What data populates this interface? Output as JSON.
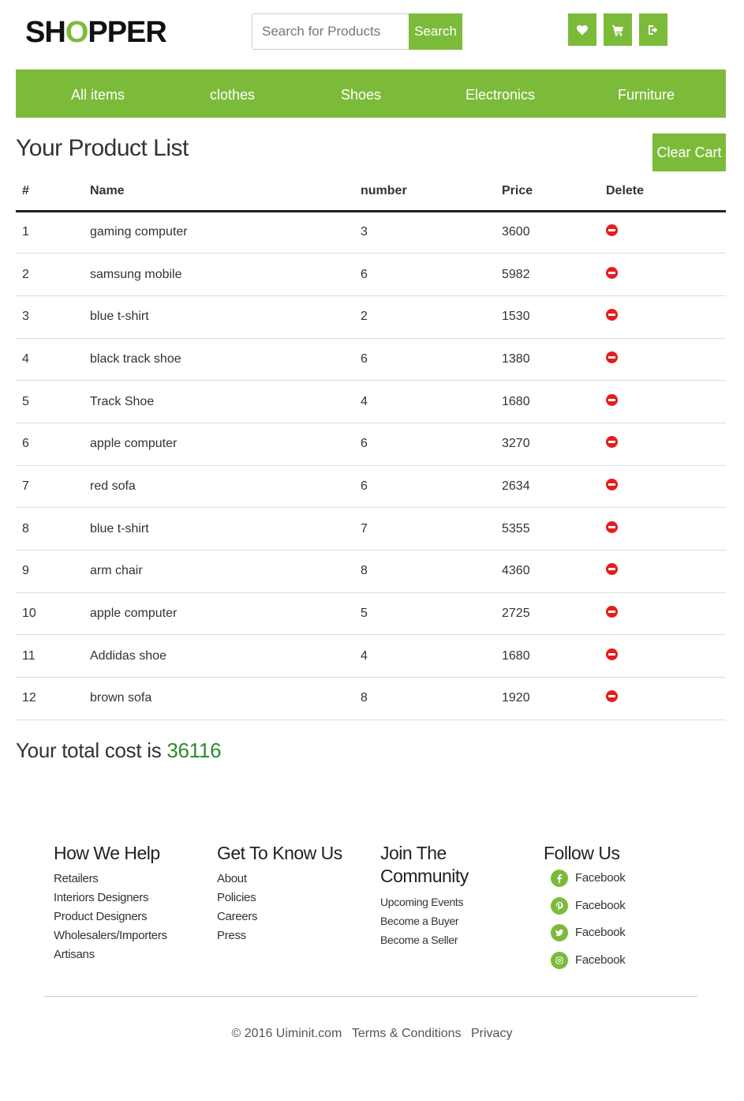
{
  "header": {
    "logo_prefix": "SH",
    "logo_o": "O",
    "logo_suffix": "PPER",
    "search_placeholder": "Search for Products",
    "search_button": "Search",
    "icons": [
      "heart-icon",
      "cart-icon",
      "logout-icon"
    ]
  },
  "nav": {
    "items": [
      "All items",
      "clothes",
      "Shoes",
      "Electronics",
      "Furniture"
    ]
  },
  "main": {
    "title": "Your Product List",
    "clear_cart": "Clear Cart",
    "columns": [
      "#",
      "Name",
      "number",
      "Price",
      "Delete"
    ],
    "rows": [
      {
        "id": "1",
        "name": "gaming computer",
        "number": "3",
        "price": "3600"
      },
      {
        "id": "2",
        "name": "samsung mobile",
        "number": "6",
        "price": "5982"
      },
      {
        "id": "3",
        "name": "blue t-shirt",
        "number": "2",
        "price": "1530"
      },
      {
        "id": "4",
        "name": "black track shoe",
        "number": "6",
        "price": "1380"
      },
      {
        "id": "5",
        "name": "Track Shoe",
        "number": "4",
        "price": "1680"
      },
      {
        "id": "6",
        "name": "apple computer",
        "number": "6",
        "price": "3270"
      },
      {
        "id": "7",
        "name": "red sofa",
        "number": "6",
        "price": "2634"
      },
      {
        "id": "8",
        "name": "blue t-shirt",
        "number": "7",
        "price": "5355"
      },
      {
        "id": "9",
        "name": "arm chair",
        "number": "8",
        "price": "4360"
      },
      {
        "id": "10",
        "name": "apple computer",
        "number": "5",
        "price": "2725"
      },
      {
        "id": "11",
        "name": "Addidas shoe",
        "number": "4",
        "price": "1680"
      },
      {
        "id": "12",
        "name": "brown sofa",
        "number": "8",
        "price": "1920"
      }
    ],
    "total_label": "Your total cost is",
    "total_value": "36116"
  },
  "footer": {
    "how_we_help": {
      "title": "How We Help",
      "links": [
        "Retailers",
        "Interiors Designers",
        "Product Designers",
        "Wholesalers/Importers",
        "Artisans"
      ]
    },
    "get_to_know": {
      "title": "Get To Know Us",
      "links": [
        "About",
        "Policies",
        "Careers",
        "Press"
      ]
    },
    "community": {
      "title_line1": "Join The",
      "title_line2": "Community",
      "links": [
        "Upcoming Events",
        "Become a Buyer",
        "Become a Seller"
      ]
    },
    "follow": {
      "title": "Follow Us",
      "links": [
        {
          "icon": "facebook-icon",
          "label": "Facebook"
        },
        {
          "icon": "pinterest-icon",
          "label": "Facebook"
        },
        {
          "icon": "twitter-icon",
          "label": "Facebook"
        },
        {
          "icon": "instagram-icon",
          "label": "Facebook"
        }
      ]
    },
    "copyright": "© 2016 Uiminit.com",
    "terms": "Terms & Conditions",
    "privacy": "Privacy"
  },
  "colors": {
    "accent": "#7cbb3a",
    "total_value": "#2e8b2e",
    "delete": "#e31e1e"
  }
}
